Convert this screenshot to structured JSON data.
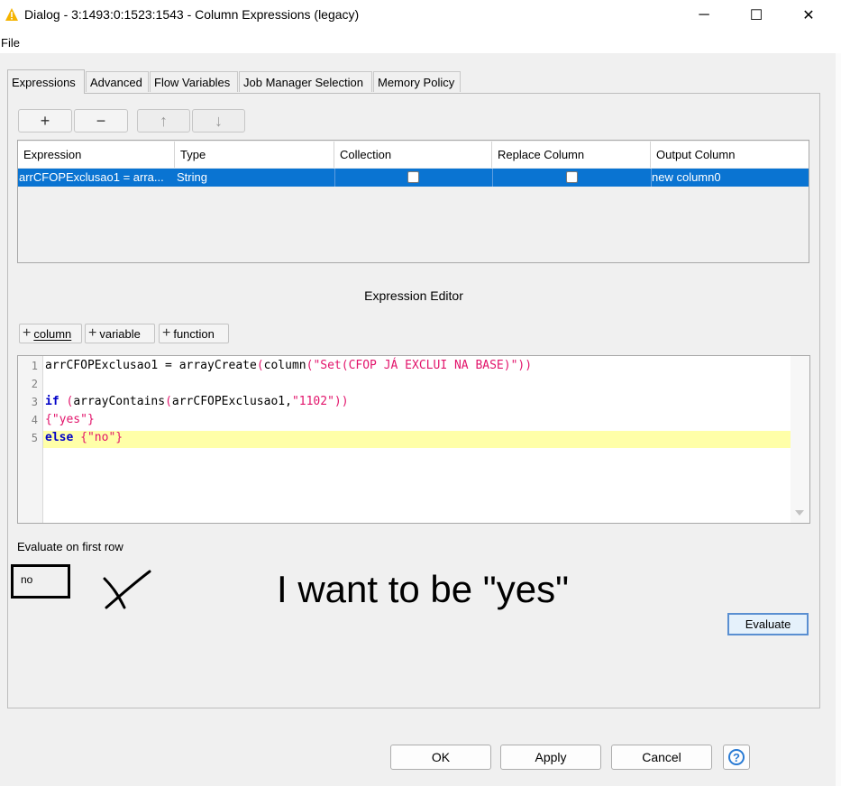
{
  "window": {
    "title": "Dialog - 3:1493:0:1523:1543 - Column Expressions (legacy)",
    "minimize_glyph": "─",
    "maximize_glyph": "☐",
    "close_glyph": "✕"
  },
  "menu": {
    "file": "File"
  },
  "tabs": [
    {
      "label": "Expressions",
      "active": true
    },
    {
      "label": "Advanced",
      "active": false
    },
    {
      "label": "Flow Variables",
      "active": false
    },
    {
      "label": "Job Manager Selection",
      "active": false
    },
    {
      "label": "Memory Policy",
      "active": false
    }
  ],
  "toolbar": {
    "add": "+",
    "remove": "−",
    "up": "↑",
    "down": "↓"
  },
  "table": {
    "headers": [
      "Expression",
      "Type",
      "Collection",
      "Replace Column",
      "Output Column"
    ],
    "rows": [
      {
        "expression": "arrCFOPExclusao1 = arra...",
        "type": "String",
        "collection": false,
        "replace_column": false,
        "output_column": "new column0"
      }
    ]
  },
  "editor": {
    "title": "Expression Editor",
    "add_column": "column",
    "add_variable": "variable",
    "add_function": "function",
    "line_numbers": [
      "1",
      "2",
      "3",
      "4",
      "5"
    ],
    "lines": [
      "arrCFOPExclusao1 = arrayCreate(column(\"Set(CFOP JÁ EXCLUI NA BASE)\"))",
      "",
      "if (arrayContains(arrCFOPExclusao1,\"1102\"))",
      "{\"yes\"}",
      "else {\"no\"}"
    ]
  },
  "evaluate": {
    "label": "Evaluate on first row",
    "result": "no",
    "annotation": "I want to be \"yes\"",
    "button": "Evaluate"
  },
  "footer": {
    "ok": "OK",
    "apply": "Apply",
    "cancel": "Cancel",
    "help": "?"
  },
  "colors": {
    "selection": "#0a74d2",
    "keyword": "#0000c8",
    "string": "#e2146b",
    "highlight": "#ffffa8"
  }
}
